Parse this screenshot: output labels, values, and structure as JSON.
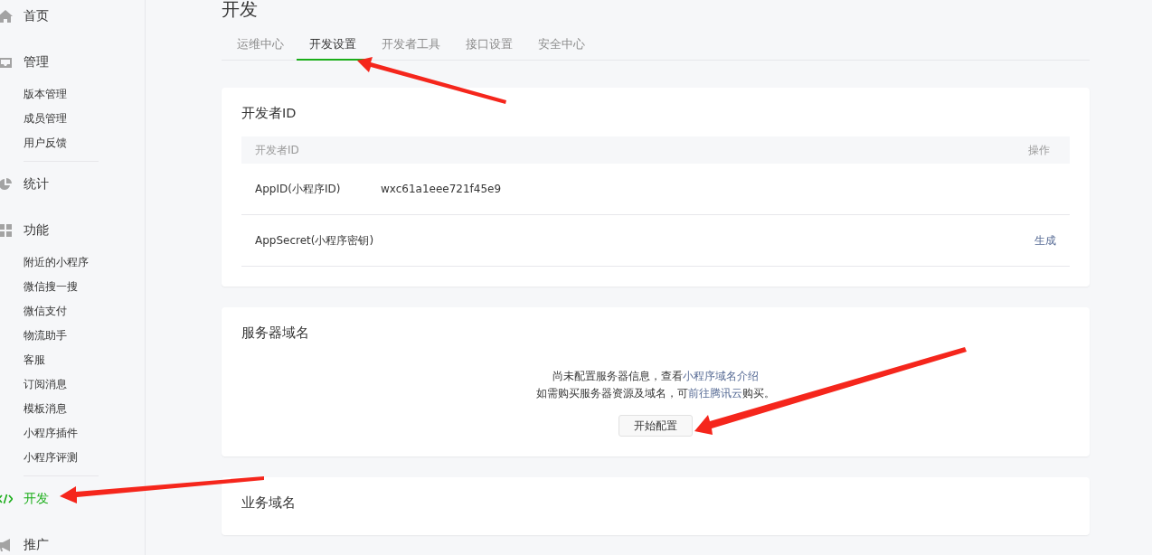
{
  "sidebar": [
    {
      "label": "首页",
      "selected": false
    },
    {
      "label": "管理",
      "selected": false,
      "children": [
        {
          "label": "版本管理"
        },
        {
          "label": "成员管理"
        },
        {
          "label": "用户反馈"
        }
      ]
    },
    {
      "label": "统计",
      "selected": false
    },
    {
      "label": "功能",
      "selected": false,
      "children": [
        {
          "label": "附近的小程序"
        },
        {
          "label": "微信搜一搜"
        },
        {
          "label": "微信支付"
        },
        {
          "label": "物流助手"
        },
        {
          "label": "客服"
        },
        {
          "label": "订阅消息"
        },
        {
          "label": "模板消息"
        },
        {
          "label": "小程序插件"
        },
        {
          "label": "小程序评测"
        }
      ]
    },
    {
      "label": "开发",
      "selected": true
    },
    {
      "label": "推广",
      "selected": false
    }
  ],
  "page_title": "开发",
  "tabs": [
    {
      "label": "运维中心",
      "selected": false
    },
    {
      "label": "开发设置",
      "selected": true
    },
    {
      "label": "开发者工具",
      "selected": false
    },
    {
      "label": "接口设置",
      "selected": false
    },
    {
      "label": "安全中心",
      "selected": false
    }
  ],
  "developer_id": {
    "title": "开发者ID",
    "columns": [
      "开发者ID",
      "操作"
    ],
    "rows": [
      {
        "name": "AppID(小程序ID)",
        "value": "wxc61a1eee721f45e9"
      },
      {
        "name": "AppSecret(小程序密钥)",
        "action": "生成"
      }
    ]
  },
  "server_domain": {
    "title": "服务器域名",
    "lines": [
      {
        "text": "尚未配置服务器信息，查看",
        "link": "小程序域名介绍"
      },
      {
        "text": "如需购买服务器资源及域名，可",
        "link": "前往腾讯云",
        "after": "购买。"
      }
    ],
    "button": "开始配置"
  },
  "business_domain": {
    "title": "业务域名"
  }
}
